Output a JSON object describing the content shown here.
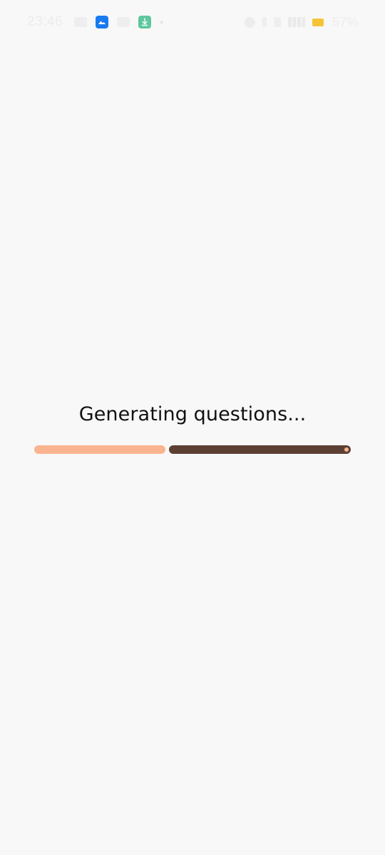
{
  "status_bar": {
    "time": "23:46",
    "battery_text": "57%",
    "icons_left": [
      "notification-icon",
      "gallery-app-icon",
      "screenshot-icon",
      "download-app-icon",
      "dot-icon"
    ],
    "icons_right": [
      "alarm-icon",
      "bluetooth-icon",
      "vibrate-icon",
      "signal-icon",
      "battery-icon"
    ],
    "colors": {
      "gallery_app": "#1a7af0",
      "download_app": "#5ec79d",
      "battery": "#f6c338"
    }
  },
  "loading": {
    "title": "Generating questions...",
    "progress": {
      "segments_total": 2,
      "segments_complete": 1,
      "colors": {
        "complete": "#fab490",
        "active": "#5c4033",
        "active_dot": "#fab490"
      }
    }
  },
  "theme": {
    "background": "#f8f8f8",
    "text": "#111111"
  }
}
